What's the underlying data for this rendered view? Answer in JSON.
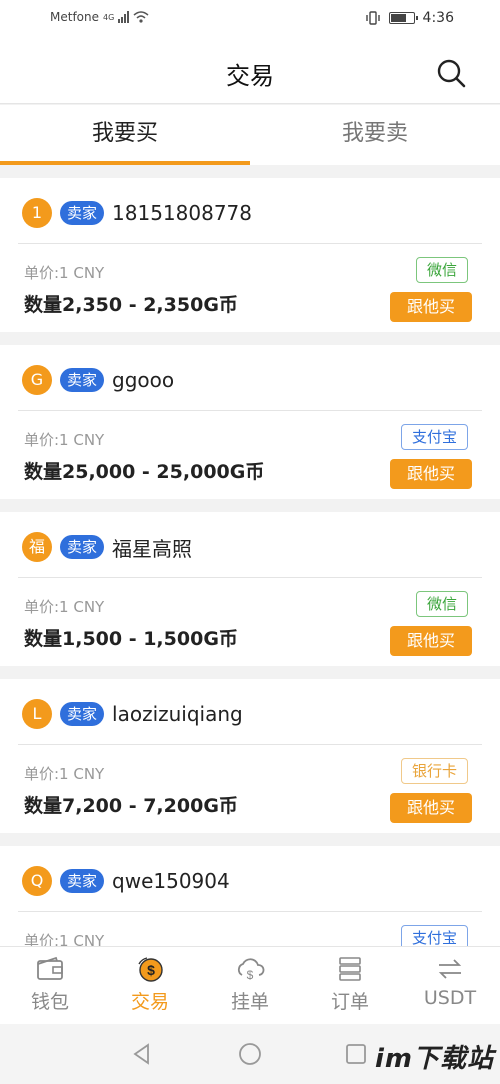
{
  "status_bar": {
    "carrier": "Metfone",
    "network": "4G",
    "time": "4:36",
    "battery_level": 0.75
  },
  "header": {
    "title": "交易",
    "search_icon": "search-icon"
  },
  "tabs": [
    {
      "label": "我要买",
      "active": true
    },
    {
      "label": "我要卖",
      "active": false
    }
  ],
  "listings": [
    {
      "avatar": "1",
      "badge": "卖家",
      "name": "18151808778",
      "price": "单价:1 CNY",
      "quantity": "数量2,350 - 2,350G币",
      "payment": "微信",
      "payment_style": "green",
      "action": "跟他买"
    },
    {
      "avatar": "G",
      "badge": "卖家",
      "name": "ggooo",
      "price": "单价:1 CNY",
      "quantity": "数量25,000 - 25,000G币",
      "payment": "支付宝",
      "payment_style": "blue",
      "action": "跟他买"
    },
    {
      "avatar": "福",
      "badge": "卖家",
      "name": "福星高照",
      "price": "单价:1 CNY",
      "quantity": "数量1,500 - 1,500G币",
      "payment": "微信",
      "payment_style": "green",
      "action": "跟他买"
    },
    {
      "avatar": "L",
      "badge": "卖家",
      "name": "laozizuiqiang",
      "price": "单价:1 CNY",
      "quantity": "数量7,200 - 7,200G币",
      "payment": "银行卡",
      "payment_style": "orange",
      "action": "跟他买"
    },
    {
      "avatar": "Q",
      "badge": "卖家",
      "name": "qwe150904",
      "price": "单价:1 CNY",
      "quantity": "",
      "payment": "支付宝",
      "payment_style": "blue",
      "action": ""
    }
  ],
  "bottom_nav": [
    {
      "label": "钱包",
      "icon": "wallet-icon",
      "active": false
    },
    {
      "label": "交易",
      "icon": "exchange-coin-icon",
      "active": true
    },
    {
      "label": "挂单",
      "icon": "cloud-dollar-icon",
      "active": false
    },
    {
      "label": "订单",
      "icon": "order-list-icon",
      "active": false
    },
    {
      "label": "USDT",
      "icon": "transfer-arrows-icon",
      "active": false
    }
  ],
  "system_nav": {
    "back_icon": "back-triangle-icon",
    "home_icon": "home-circle-icon",
    "recents_icon": "recents-square-icon"
  },
  "watermark": "im下载站",
  "colors": {
    "accent": "#f39a1c",
    "badge_blue": "#2f6fdc",
    "wechat_green": "#3aa53a",
    "bank_orange": "#e9a43a"
  }
}
